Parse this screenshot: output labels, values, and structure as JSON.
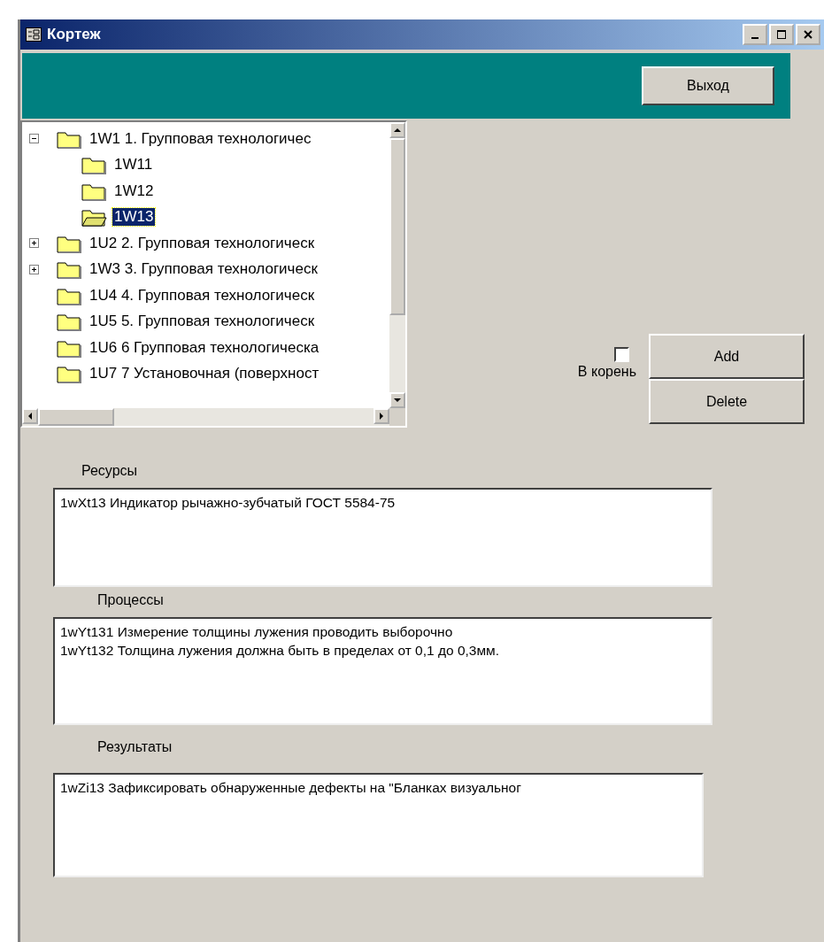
{
  "window": {
    "title": "Кортеж"
  },
  "exit_button": "Выход",
  "tree": [
    {
      "label": "1W1  1. Групповая технологичес",
      "expanded": true,
      "selected": false,
      "children": [
        {
          "label": "1W11",
          "selected": false
        },
        {
          "label": "1W12",
          "selected": false
        },
        {
          "label": "1W13",
          "selected": true
        }
      ]
    },
    {
      "label": "1U2 2. Групповая технологическ",
      "expanded": false,
      "selected": false
    },
    {
      "label": "1W3 3. Групповая технологическ",
      "expanded": false,
      "selected": false
    },
    {
      "label": "1U4 4. Групповая технологическ",
      "selected": false
    },
    {
      "label": "1U5 5. Групповая технологическ",
      "selected": false
    },
    {
      "label": "1U6 6 Групповая технологическа",
      "selected": false
    },
    {
      "label": "1U7 7 Установочная (поверхност",
      "selected": false
    }
  ],
  "root_checkbox": {
    "label": "В корень",
    "checked": false
  },
  "buttons": [
    "Add",
    "Delete"
  ],
  "sections": [
    {
      "label": "Ресурсы",
      "lines": [
        "1wXt13 Индикатор рычажно-зубчатый ГОСТ 5584-75"
      ]
    },
    {
      "label": "Процессы",
      "lines": [
        "1wYt131 Измерение толщины лужения проводить выборочно",
        "1wYt132 Толщина лужения должна быть в пределах от 0,1 до 0,3мм."
      ]
    },
    {
      "label": "Результаты",
      "lines": [
        "1wZi13 Зафиксировать обнаруженные дефекты на \"Бланках визуальног"
      ]
    }
  ]
}
